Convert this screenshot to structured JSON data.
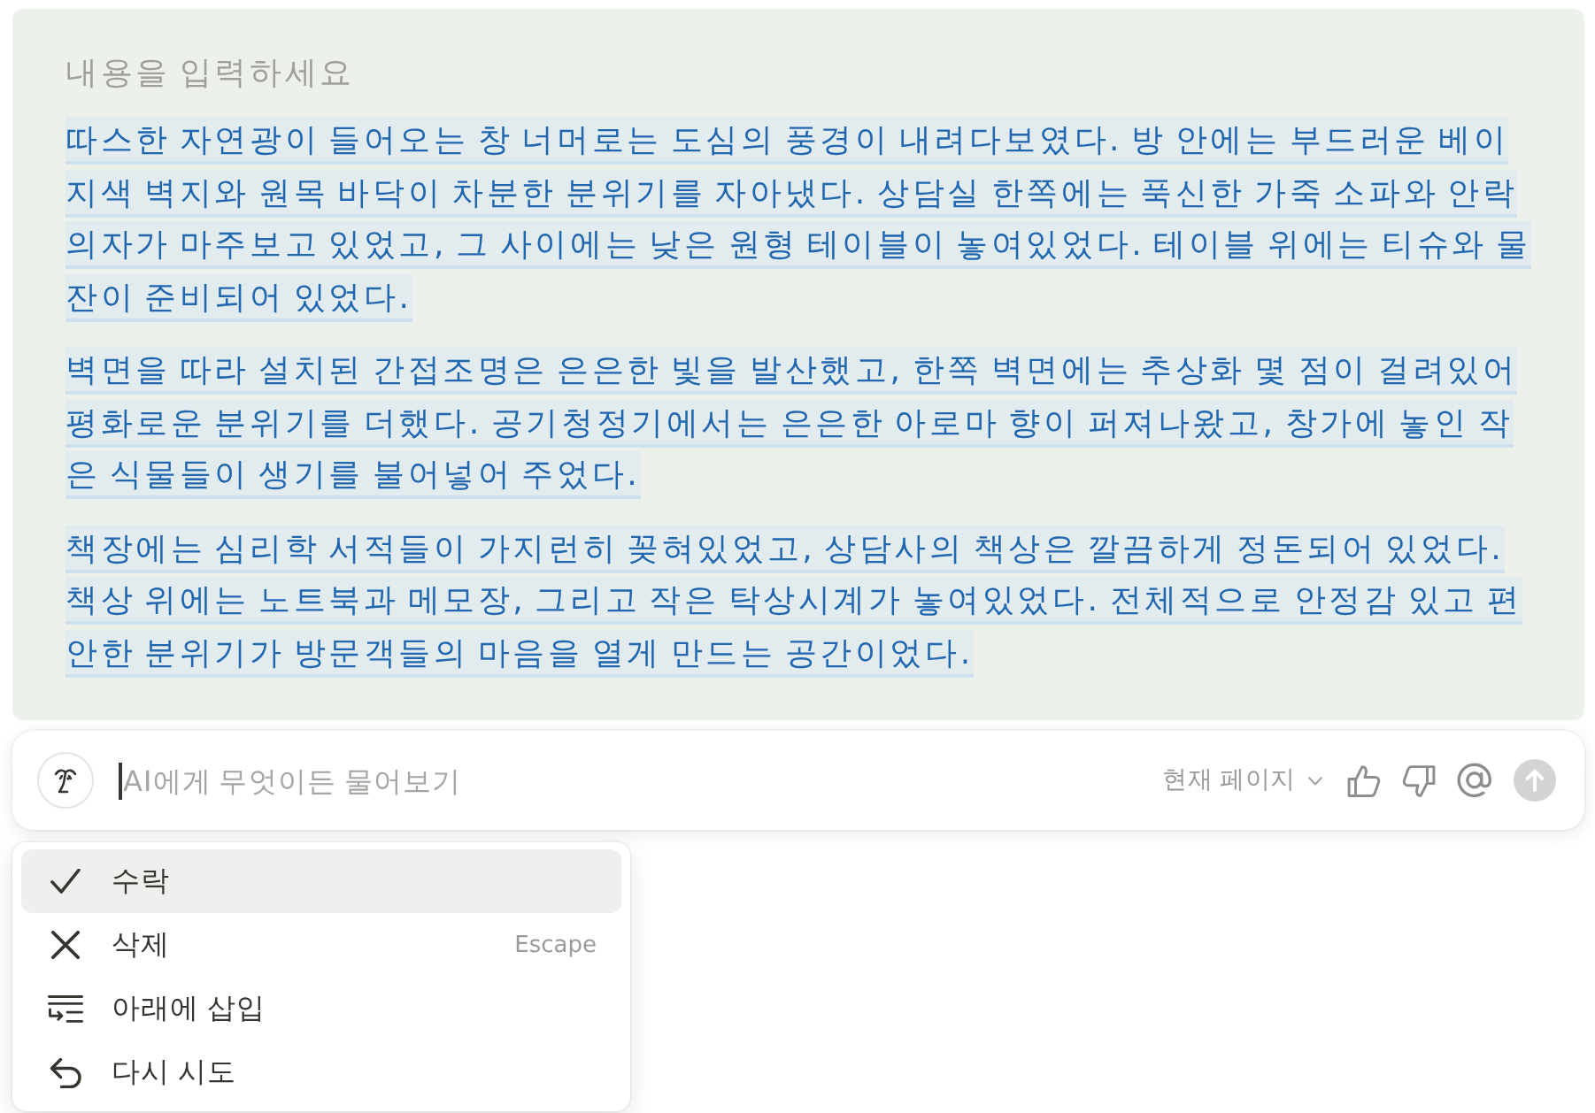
{
  "editor": {
    "title": {
      "placeholder": "내용을 입력하세요"
    },
    "paragraphs": [
      {
        "text": "따스한 자연광이 들어오는 창 너머로는 도심의 풍경이 내려다보였다. 방 안에는 부드러운 베이지색 벽지와 원목 바닥이 차분한 분위기를 자아냈다. 상담실 한쪽에는 푹신한 가죽 소파와 안락의자가 마주보고 있었고, 그 사이에는 낮은 원형 테이블이 놓여있었다. 테이블 위에는 티슈와 물잔이 준비되어 있었다.",
        "suggested": true
      },
      {
        "text": "벽면을 따라 설치된 간접조명은 은은한 빛을 발산했고, 한쪽 벽면에는 추상화 몇 점이 걸려있어 평화로운 분위기를 더했다. 공기청정기에서는 은은한 아로마 향이 퍼져나왔고, 창가에 놓인 작은 식물들이 생기를 불어넣어 주었다.",
        "suggested": true
      },
      {
        "text": "책장에는 심리학 서적들이 가지런히 꽂혀있었고, 상담사의 책상은 깔끔하게 정돈되어 있었다. 책상 위에는 노트북과 메모장, 그리고 작은 탁상시계가 놓여있었다. 전체적으로 안정감 있고 편안한 분위기가 방문객들의 마음을 열게 만드는 공간이었다.",
        "suggested": true
      }
    ]
  },
  "ai_bar": {
    "focused": true,
    "placeholder": "AI에게 무엇이든 물어보기",
    "scope": "현재 페이지"
  },
  "menu": {
    "items": [
      {
        "kind": "accept",
        "label": "수락",
        "selected": true
      },
      {
        "kind": "discard",
        "label": "삭제",
        "shortcut": "Escape",
        "selected": false
      },
      {
        "kind": "insert_below",
        "label": "아래에 삽입",
        "selected": false
      },
      {
        "kind": "retry",
        "label": "다시 시도",
        "selected": false
      }
    ]
  }
}
